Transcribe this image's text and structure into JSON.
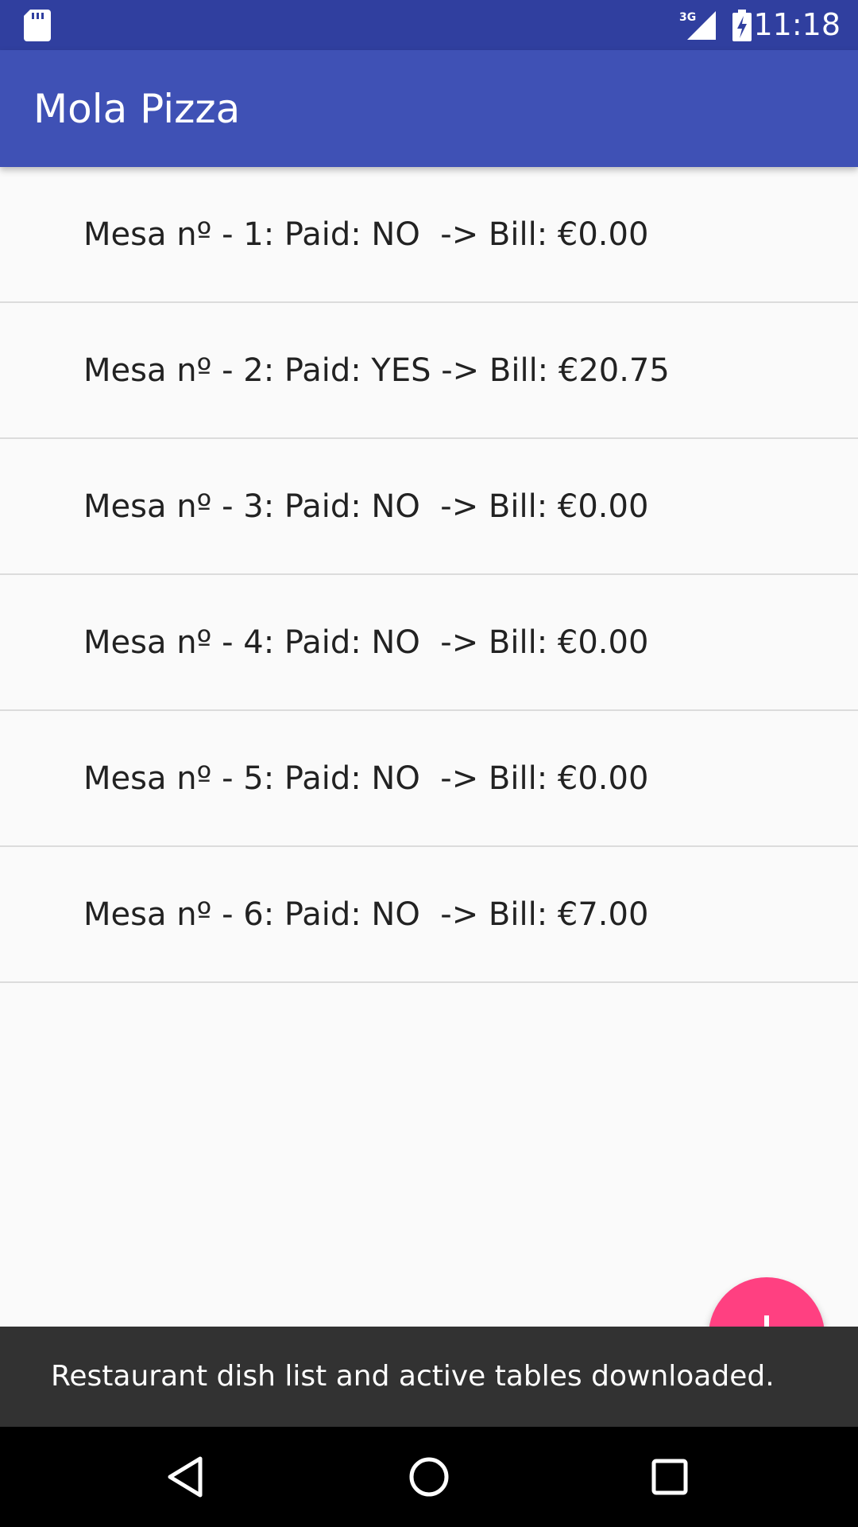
{
  "status_bar": {
    "time": "11:18",
    "network": "3G"
  },
  "app_bar": {
    "title": "Mola Pizza"
  },
  "tables": [
    {
      "label": "Mesa nº - 1: Paid: NO  -> Bill: €0.00"
    },
    {
      "label": "Mesa nº - 2: Paid: YES -> Bill: €20.75"
    },
    {
      "label": "Mesa nº - 3: Paid: NO  -> Bill: €0.00"
    },
    {
      "label": "Mesa nº - 4: Paid: NO  -> Bill: €0.00"
    },
    {
      "label": "Mesa nº - 5: Paid: NO  -> Bill: €0.00"
    },
    {
      "label": "Mesa nº - 6: Paid: NO  -> Bill: €7.00"
    }
  ],
  "fab": {
    "icon": "plus-icon",
    "color": "#ff4081"
  },
  "snackbar": {
    "message": "Restaurant dish list and active tables downloaded."
  },
  "colors": {
    "primary": "#3f51b5",
    "primary_dark": "#303f9f",
    "accent": "#ff4081"
  }
}
